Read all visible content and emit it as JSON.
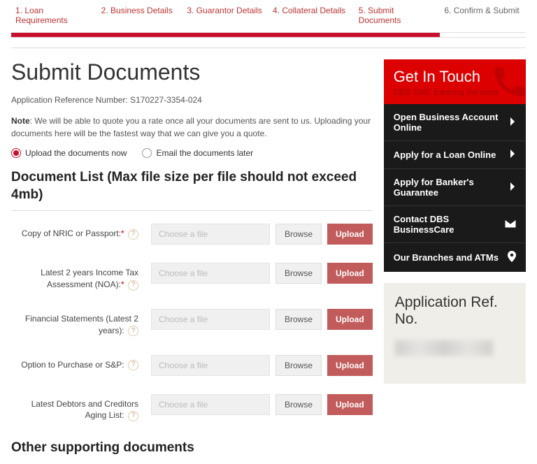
{
  "stepper": {
    "steps": [
      {
        "label": "1. Loan Requirements",
        "active": true
      },
      {
        "label": "2. Business Details",
        "active": true
      },
      {
        "label": "3. Guarantor Details",
        "active": true
      },
      {
        "label": "4. Collateral Details",
        "active": true
      },
      {
        "label": "5. Submit Documents",
        "active": true
      },
      {
        "label": "6. Confirm & Submit",
        "active": false
      }
    ]
  },
  "page": {
    "title": "Submit Documents",
    "ref_label": "Application Reference Number: ",
    "ref_number": "S170227-3354-024",
    "note_prefix": "Note",
    "note_body": ": We will be able to quote you a rate once all your documents are sent to us. Uploading your documents here will be the fastest way that we can give you a quote.",
    "radio_upload": "Upload the documents now",
    "radio_email": "Email the documents later",
    "doclist_heading": "Document List (Max file size per file should not exceed 4mb)",
    "other_heading": "Other supporting documents",
    "file_placeholder": "Choose a file",
    "browse_label": "Browse",
    "upload_label": "Upload"
  },
  "docs": [
    {
      "label": "Copy of NRIC or Passport:",
      "required": true,
      "help": true
    },
    {
      "label": "Latest 2 years Income Tax Assessment (NOA):",
      "required": true,
      "help": true
    },
    {
      "label": "Financial Statements (Latest 2 years):",
      "required": false,
      "help": true
    },
    {
      "label": "Option to Purchase or S&P:",
      "required": false,
      "help": true
    },
    {
      "label": "Latest Debtors and Creditors Aging List:",
      "required": false,
      "help": true
    }
  ],
  "sidebar": {
    "touch_title": "Get In Touch",
    "touch_sub": "DBS SME Banking Services",
    "links": [
      {
        "label": "Open Business Account Online",
        "icon": "chevron"
      },
      {
        "label": "Apply for a Loan Online",
        "icon": "chevron"
      },
      {
        "label": "Apply for Banker's Guarantee",
        "icon": "chevron"
      },
      {
        "label": "Contact DBS BusinessCare",
        "icon": "mail"
      },
      {
        "label": "Our Branches and ATMs",
        "icon": "pin"
      }
    ],
    "refbox_title": "Application Ref. No."
  }
}
